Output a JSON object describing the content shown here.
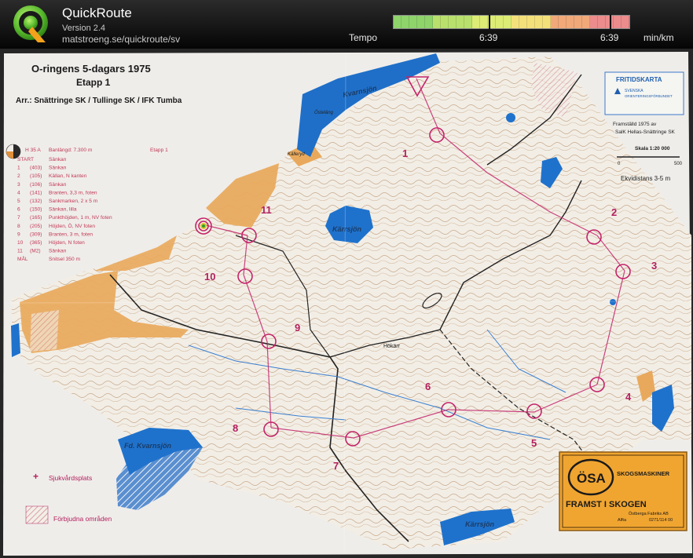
{
  "app": {
    "title": "QuickRoute",
    "version": "Version 2.4",
    "url": "matstroeng.se/quickroute/sv"
  },
  "pace_bar": {
    "label": "Tempo",
    "left_value": "6:39",
    "right_value": "6:39",
    "unit": "min/km",
    "colors": [
      "#8fd36b",
      "#b9e06d",
      "#ddec74",
      "#f4e07a",
      "#f1a979",
      "#ec8c8c"
    ]
  },
  "map": {
    "title": "O-ringens 5-dagars 1975",
    "stage": "Etapp 1",
    "organizers": "Arr.: Snättringe SK / Tullinge SK / IFK Tumba",
    "badge_title": "FRITIDSKARTA",
    "badge_sub1": "SVENSKA",
    "badge_sub2": "ORIENTERINGSFÖRBUNDET",
    "credit1": "Framställd 1975 av",
    "credit2": "SalK Hellas-Snättringe SK",
    "scale_label": "Skala 1:20 000",
    "scale_0": "0",
    "scale_500": "500",
    "equidistance": "Ekvidistans 3-5 m",
    "course_header": [
      "H 35 A",
      "Banlängd: 7.300 m",
      "Etapp 1"
    ],
    "controls": [
      {
        "n": "START",
        "c": "",
        "d": "Sänkan"
      },
      {
        "n": "1",
        "c": "(403)",
        "d": "Sänkan"
      },
      {
        "n": "2",
        "c": "(105)",
        "d": "Källan, N kanten"
      },
      {
        "n": "3",
        "c": "(106)",
        "d": "Sänkan"
      },
      {
        "n": "4",
        "c": "(141)",
        "d": "Branten, 3,3 m, foten"
      },
      {
        "n": "5",
        "c": "(132)",
        "d": "Sankmarken, 2 x 5 m"
      },
      {
        "n": "6",
        "c": "(150)",
        "d": "Sänkan, lilla"
      },
      {
        "n": "7",
        "c": "(165)",
        "d": "Punkthöjden, 1 m, NV foten"
      },
      {
        "n": "8",
        "c": "(205)",
        "d": "Höjden, Ö, NV foten"
      },
      {
        "n": "9",
        "c": "(309)",
        "d": "Branten, 3 m, foten"
      },
      {
        "n": "10",
        "c": "(365)",
        "d": "Höjden, N foten"
      },
      {
        "n": "11",
        "c": "(M2)",
        "d": "Sänkan"
      },
      {
        "n": "MÅL",
        "c": "",
        "d": "Snitsel 350 m"
      }
    ],
    "lake_labels": [
      "Kvarnsjön",
      "Kärrsjön",
      "Fd. Kvarnsjön",
      "Kärrsjön",
      "Hökärr",
      "Källeryd",
      "Östeläng"
    ],
    "control_numbers": [
      "1",
      "2",
      "3",
      "4",
      "5",
      "6",
      "7",
      "8",
      "9",
      "10",
      "11"
    ],
    "legend_first_aid": "Sjukvårdsplats",
    "legend_forbidden": "Förbjudna områden",
    "ad_brand": "ÖSA",
    "ad_sub": "SKOGSMASKINER",
    "ad_slogan": "FRAMST I SKOGEN",
    "ad_company": "Östberga Fabriks AB",
    "ad_place": "Alfta",
    "ad_phone": "0271/114 00"
  }
}
